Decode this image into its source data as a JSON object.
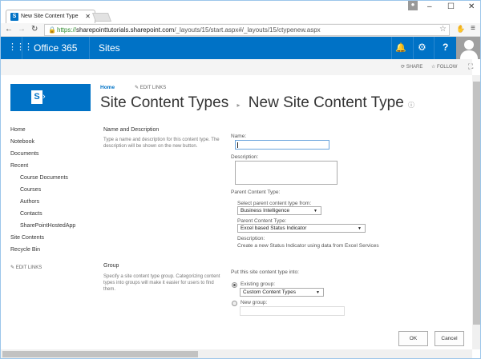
{
  "browser": {
    "tab_title": "New Site Content Type",
    "url_scheme": "https://",
    "url_domain": "sharepointtutorials.sharepoint.com",
    "url_path": "/_layouts/15/start.aspx#/_layouts/15/ctypenew.aspx"
  },
  "suite": {
    "app": "Office 365",
    "section": "Sites"
  },
  "ribbon": {
    "share": "SHARE",
    "follow": "FOLLOW"
  },
  "header": {
    "home": "Home",
    "edit_links": "EDIT LINKS",
    "breadcrumb_parent": "Site Content Types",
    "page_title": "New Site Content Type"
  },
  "sidebar": {
    "items": [
      "Home",
      "Notebook",
      "Documents",
      "Recent"
    ],
    "recent": [
      "Course Documents",
      "Courses",
      "Authors",
      "Contacts",
      "SharePointHostedApp"
    ],
    "bottom": [
      "Site Contents",
      "Recycle Bin"
    ],
    "edit_links": "EDIT LINKS"
  },
  "form": {
    "name_section": {
      "title": "Name and Description",
      "desc": "Type a name and description for this content type. The description will be shown on the new button."
    },
    "name_label": "Name:",
    "name_value": "",
    "description_label": "Description:",
    "parent_label": "Parent Content Type:",
    "select_from_label": "Select parent content type from:",
    "select_from_value": "Business Intelligence",
    "parent_type_label": "Parent Content Type:",
    "parent_type_value": "Excel based Status Indicator",
    "parent_desc_label": "Description:",
    "parent_desc": "Create a new Status Indicator using data from Excel Services",
    "group_section": {
      "title": "Group",
      "desc": "Specify a site content type group. Categorizing content types into groups will make it easier for users to find them."
    },
    "put_into_label": "Put this site content type into:",
    "existing_group_label": "Existing group:",
    "existing_group_value": "Custom Content Types",
    "new_group_label": "New group:",
    "ok": "OK",
    "cancel": "Cancel"
  }
}
